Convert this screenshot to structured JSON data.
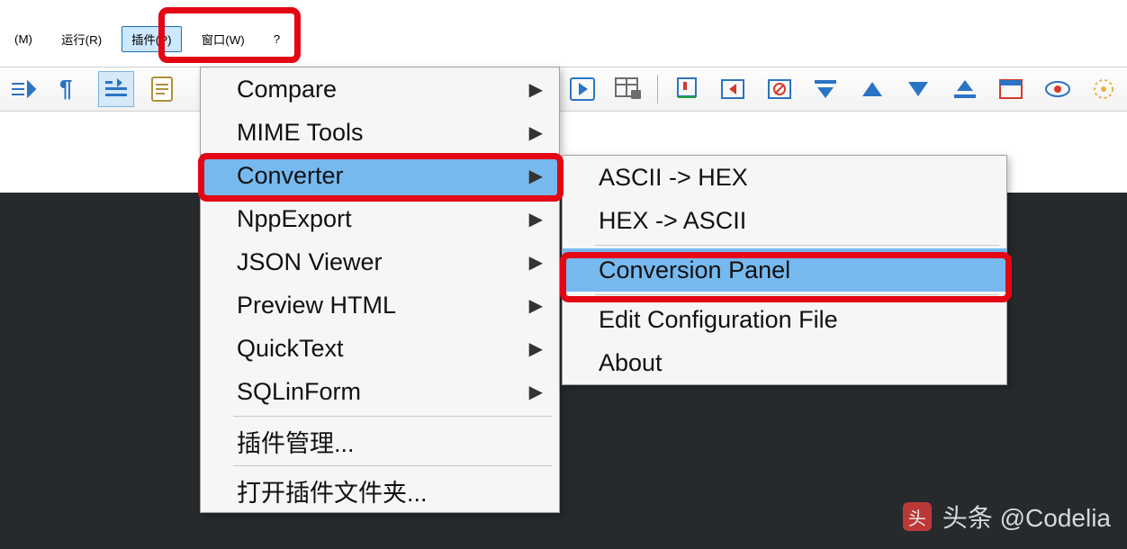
{
  "menubar": {
    "items": [
      {
        "label": "(M)"
      },
      {
        "label": "运行(R)"
      },
      {
        "label": "插件(P)",
        "active": true
      },
      {
        "label": "窗口(W)"
      },
      {
        "label": "?"
      }
    ]
  },
  "toolbar_icons": [
    "linkify-icon",
    "paragraph-icon",
    "indent-icon",
    "script-icon",
    "play-right-icon",
    "table-lock-icon",
    "marker-icon",
    "color-prev-icon",
    "color-delete-icon",
    "collapse-icon",
    "up-icon",
    "down-icon",
    "collapse-bottom-icon",
    "panel-icon",
    "eye-icon",
    "misc-icon"
  ],
  "plugins_menu": {
    "items": [
      {
        "label": "Compare",
        "submenu": true
      },
      {
        "label": "MIME Tools",
        "submenu": true
      },
      {
        "label": "Converter",
        "submenu": true,
        "highlight": true
      },
      {
        "label": "NppExport",
        "submenu": true
      },
      {
        "label": "JSON Viewer",
        "submenu": true
      },
      {
        "label": "Preview HTML",
        "submenu": true
      },
      {
        "label": "QuickText",
        "submenu": true
      },
      {
        "label": "SQLinForm",
        "submenu": true
      }
    ],
    "footer1": "插件管理...",
    "footer2": "打开插件文件夹..."
  },
  "converter_submenu": {
    "items": [
      {
        "label": "ASCII -> HEX"
      },
      {
        "label": "HEX -> ASCII"
      },
      {
        "label": "Conversion Panel",
        "highlight": true
      },
      {
        "label": "Edit Configuration File"
      },
      {
        "label": "About"
      }
    ]
  },
  "watermark": {
    "text": "头条 @Codelia"
  },
  "colors": {
    "highlight_red": "#e30613",
    "menu_highlight": "#76b9ef",
    "dark_bg": "#262a2d"
  }
}
